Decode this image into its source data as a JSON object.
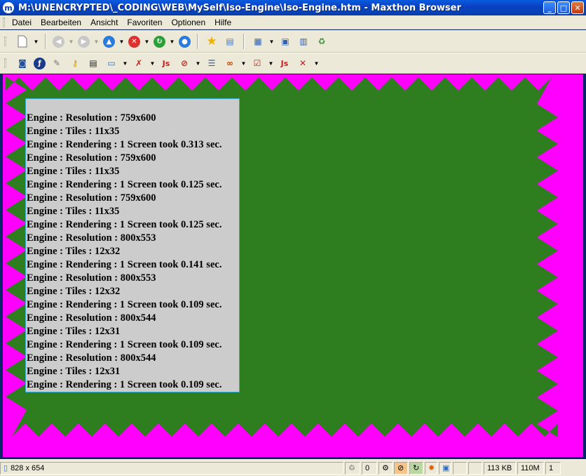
{
  "window": {
    "title": "M:\\UNENCRYPTED\\_CODING\\WEB\\MySelf\\Iso-Engine\\Iso-Engine.htm - Maxthon Browser",
    "app_icon": "m",
    "buttons": [
      "minimize-icon",
      "maximize-icon",
      "close-icon"
    ]
  },
  "menu": {
    "items": [
      {
        "label": "Datei"
      },
      {
        "label": "Bearbeiten"
      },
      {
        "label": "Ansicht"
      },
      {
        "label": "Favoriten"
      },
      {
        "label": "Optionen"
      },
      {
        "label": "Hilfe"
      }
    ]
  },
  "toolbar1": {
    "icons": [
      "new-page-icon",
      "back-icon",
      "forward-icon",
      "up-icon",
      "stop-icon",
      "refresh-icon",
      "home-icon",
      "favorites-icon",
      "collection-icon",
      "window-layout-icon",
      "full-screen-icon",
      "tile-icon",
      "recycle-icon"
    ]
  },
  "toolbar2": {
    "icons": [
      "screenshot-icon",
      "flash-icon",
      "link-icon",
      "key-icon",
      "document-icon",
      "form-icon",
      "popup-blocker-icon",
      "javascript-icon",
      "block-icon",
      "list-icon",
      "plugin-icon",
      "check-icon",
      "javascript-off-icon",
      "close-all-icon"
    ],
    "js_label": "Js"
  },
  "viewport": {
    "background_color": "#FF00FF",
    "ground_color": "#2E7D1E",
    "panel_color": "#CCCCCC",
    "panel_border_color": "#33AACC"
  },
  "log": [
    "Engine : Resolution : 759x600",
    "Engine : Tiles : 11x35",
    "Engine : Rendering : 1 Screen took 0.313 sec.",
    "Engine : Resolution : 759x600",
    "Engine : Tiles : 11x35",
    "Engine : Rendering : 1 Screen took 0.125 sec.",
    "Engine : Resolution : 759x600",
    "Engine : Tiles : 11x35",
    "Engine : Rendering : 1 Screen took 0.125 sec.",
    "Engine : Resolution : 800x553",
    "Engine : Tiles : 12x32",
    "Engine : Rendering : 1 Screen took 0.141 sec.",
    "Engine : Resolution : 800x553",
    "Engine : Tiles : 12x32",
    "Engine : Rendering : 1 Screen took 0.109 sec.",
    "Engine : Resolution : 800x544",
    "Engine : Tiles : 12x31",
    "Engine : Rendering : 1 Screen took 0.109 sec.",
    "Engine : Resolution : 800x544",
    "Engine : Tiles : 12x31",
    "Engine : Rendering : 1 Screen took 0.109 sec."
  ],
  "status": {
    "size": "828 x 654",
    "count": "0",
    "memory_page": "113 KB",
    "memory_total": "110M",
    "tabs": "1"
  }
}
